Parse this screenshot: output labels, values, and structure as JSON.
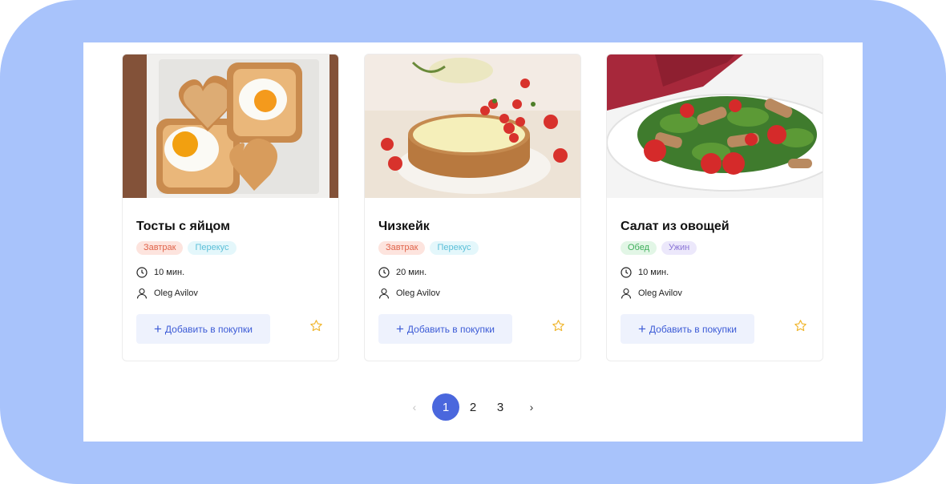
{
  "colors": {
    "frame": "#a8c3fb",
    "accent": "#4a67dd",
    "button_bg": "#eef2fd",
    "button_text": "#3c5bd6",
    "star": "#f0b429"
  },
  "cards": [
    {
      "title": "Тосты с яйцом",
      "image": "toast-with-egg-photo",
      "tags": [
        {
          "label": "Завтрак",
          "bg": "#fde4de",
          "fg": "#e0644b"
        },
        {
          "label": "Перекус",
          "bg": "#e4f7fb",
          "fg": "#5bbfd8"
        }
      ],
      "time": "10 мин.",
      "author": "Oleg Avilov",
      "add_label": "Добавить в покупки",
      "favorite_icon": "star-outline"
    },
    {
      "title": "Чизкейк",
      "image": "cheesecake-photo",
      "tags": [
        {
          "label": "Завтрак",
          "bg": "#fde4de",
          "fg": "#e0644b"
        },
        {
          "label": "Перекус",
          "bg": "#e4f7fb",
          "fg": "#5bbfd8"
        }
      ],
      "time": "20 мин.",
      "author": "Oleg Avilov",
      "add_label": "Добавить в покупки",
      "favorite_icon": "star-outline"
    },
    {
      "title": "Салат из овощей",
      "image": "vegetable-salad-photo",
      "tags": [
        {
          "label": "Обед",
          "bg": "#e2f6e6",
          "fg": "#3fae5c"
        },
        {
          "label": "Ужин",
          "bg": "#ece8fb",
          "fg": "#8a74d6"
        }
      ],
      "time": "10 мин.",
      "author": "Oleg Avilov",
      "add_label": "Добавить в покупки",
      "favorite_icon": "star-outline"
    }
  ],
  "pagination": {
    "prev": "‹",
    "next": "›",
    "pages": [
      "1",
      "2",
      "3"
    ],
    "current": "1"
  }
}
